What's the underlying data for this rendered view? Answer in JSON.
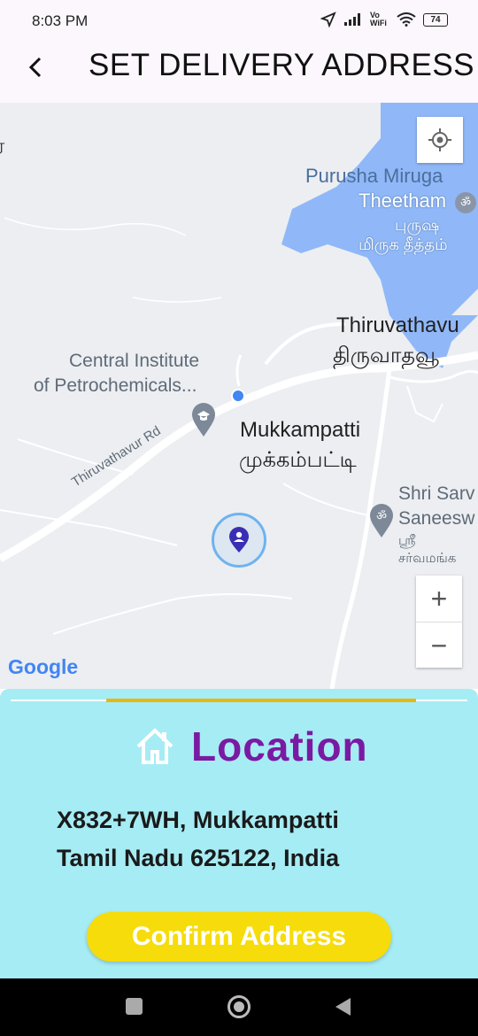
{
  "status_bar": {
    "time": "8:03 PM",
    "battery": "74",
    "network_label": "Vo WiFi"
  },
  "header": {
    "back_icon": "arrow-back-icon",
    "title": "SET DELIVERY ADDRESS"
  },
  "map": {
    "labels": {
      "place1_en_line1": "Purusha Miruga",
      "place1_en_line2": "Theetham",
      "place1_ta_line1": "புருஷ",
      "place1_ta_line2": "மிருக தீத்தம்",
      "place2_en": "Thiruvathavu",
      "place2_ta": "திருவாதவூ",
      "place3_line1": "Central Institute",
      "place3_line2": "of Petrochemicals...",
      "place4_en": "Mukkampatti",
      "place4_ta": "முக்கம்பட்டி",
      "place5_en_line1": "Shri Sarv",
      "place5_en_line2": "Saneesw",
      "place5_ta_line1": "ஸ்ரீ",
      "place5_ta_line2": "சர்வமங்க",
      "road": "Thiruvathavur Rd",
      "edge_glyph": "ர",
      "attribution": "Google"
    },
    "controls": {
      "zoom_in": "+",
      "zoom_out": "−"
    }
  },
  "location_card": {
    "title": "Location",
    "address_line1": "X832+7WH, Mukkampatti",
    "address_line2": "Tamil Nadu 625122, India",
    "confirm_label": "Confirm Address"
  },
  "colors": {
    "accent_purple": "#7a1aa3",
    "button_yellow": "#f6dc0a",
    "sheet_bg": "#a6ecf4",
    "water": "#90b8f8"
  }
}
